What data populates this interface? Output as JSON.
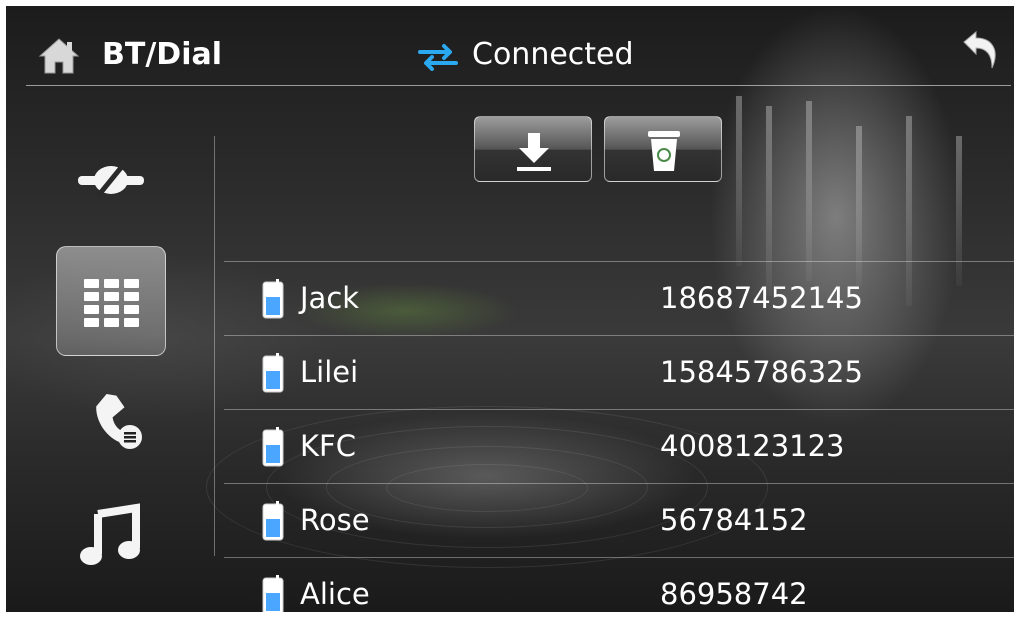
{
  "header": {
    "title": "BT/Dial",
    "connection_status": "Connected",
    "home_icon": "home-icon",
    "connection_icon": "swap-arrows-icon",
    "back_icon": "back-arrow-icon"
  },
  "sidebar": {
    "items": [
      {
        "id": "link",
        "icon": "bluetooth-link-icon",
        "active": false
      },
      {
        "id": "dialpad",
        "icon": "dialpad-icon",
        "active": true
      },
      {
        "id": "call-log",
        "icon": "call-log-icon",
        "active": false
      },
      {
        "id": "music",
        "icon": "music-icon",
        "active": false
      }
    ]
  },
  "toolbar": {
    "download_icon": "download-icon",
    "delete_icon": "trash-icon"
  },
  "contacts": [
    {
      "name": "Jack",
      "number": "18687452145"
    },
    {
      "name": "Lilei",
      "number": "15845786325"
    },
    {
      "name": "KFC",
      "number": "4008123123"
    },
    {
      "name": "Rose",
      "number": "56784152"
    },
    {
      "name": "Alice",
      "number": "86958742"
    }
  ],
  "colors": {
    "accent": "#2aa8f0",
    "text": "#ffffff",
    "phone_icon": "#4aa6ff"
  }
}
